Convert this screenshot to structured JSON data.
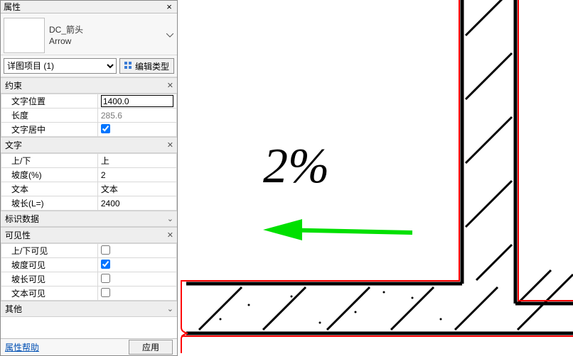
{
  "panel": {
    "title": "属性",
    "close_glyph": "×",
    "type": {
      "name": "DC_箭头",
      "sub": "Arrow"
    },
    "filter_option": "详图项目 (1)",
    "edit_type_label": "编辑类型",
    "groups": {
      "constraints": {
        "title": "约束",
        "text_position": {
          "label": "文字位置",
          "value": "1400.0"
        },
        "length": {
          "label": "长度",
          "value": "285.6"
        },
        "text_center": {
          "label": "文字居中",
          "checked": true
        }
      },
      "text": {
        "title": "文字",
        "up_down": {
          "label": "上/下",
          "value": "上"
        },
        "slope": {
          "label": "坡度(%)",
          "value": "2"
        },
        "text": {
          "label": "文本",
          "value": "文本"
        },
        "slope_len": {
          "label": "坡长(L=)",
          "value": "2400"
        }
      },
      "identity": {
        "title": "标识数据"
      },
      "visibility": {
        "title": "可见性",
        "ud_vis": {
          "label": "上/下可见",
          "checked": false
        },
        "slope_vis": {
          "label": "坡度可见",
          "checked": true
        },
        "len_vis": {
          "label": "坡长可见",
          "checked": false
        },
        "text_vis": {
          "label": "文本可见",
          "checked": false
        }
      },
      "other": {
        "title": "其他"
      }
    },
    "footer": {
      "help": "属性帮助",
      "apply": "应用"
    }
  },
  "canvas": {
    "slope_label": "2%"
  }
}
